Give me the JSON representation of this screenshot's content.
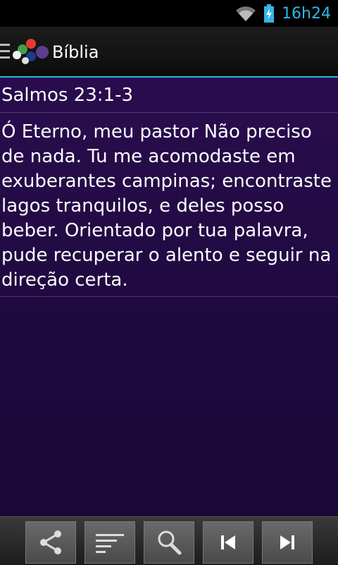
{
  "status_bar": {
    "time": "16h24",
    "battery_color": "#33b5e5"
  },
  "action_bar": {
    "title": "Bíblia",
    "accent": "#33b5e5"
  },
  "content": {
    "reference": "Salmos 23:1-3",
    "verse": "Ó Eterno, meu pastor Não preciso de nada. Tu me acomodaste em exuberantes campinas; encontraste lagos tranquilos, e deles posso beber. Orientado por tua palavra, pude recuperar o alento e seguir na direção certa.",
    "background": "#1e0a3e"
  },
  "bottom_bar": {
    "buttons": [
      {
        "icon": "share-icon"
      },
      {
        "icon": "sort-icon"
      },
      {
        "icon": "search-icon"
      },
      {
        "icon": "skip-previous-icon"
      },
      {
        "icon": "skip-next-icon"
      }
    ]
  }
}
